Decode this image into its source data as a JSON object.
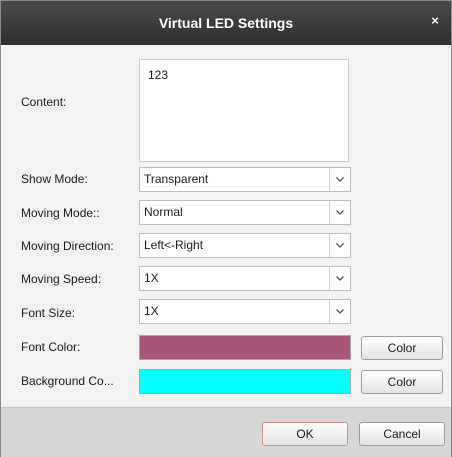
{
  "dialog": {
    "title": "Virtual LED Settings",
    "close_symbol": "×"
  },
  "fields": {
    "content_label": "Content:",
    "content_value": "123",
    "show_mode_label": "Show Mode:",
    "show_mode_value": "Transparent",
    "moving_mode_label": "Moving Mode::",
    "moving_mode_value": "Normal",
    "moving_direction_label": "Moving Direction:",
    "moving_direction_value": "Left<-Right",
    "moving_speed_label": "Moving Speed:",
    "moving_speed_value": "1X",
    "font_size_label": "Font Size:",
    "font_size_value": "1X",
    "font_color_label": "Font Color:",
    "font_color_value": "#a8577a",
    "font_color_button": "Color",
    "background_color_label": "Background Co...",
    "background_color_value": "#00ffff",
    "background_color_button": "Color"
  },
  "footer": {
    "ok_label": "OK",
    "cancel_label": "Cancel"
  },
  "icons": {
    "close": "close-icon",
    "dropdown": "chevron-down-icon"
  }
}
